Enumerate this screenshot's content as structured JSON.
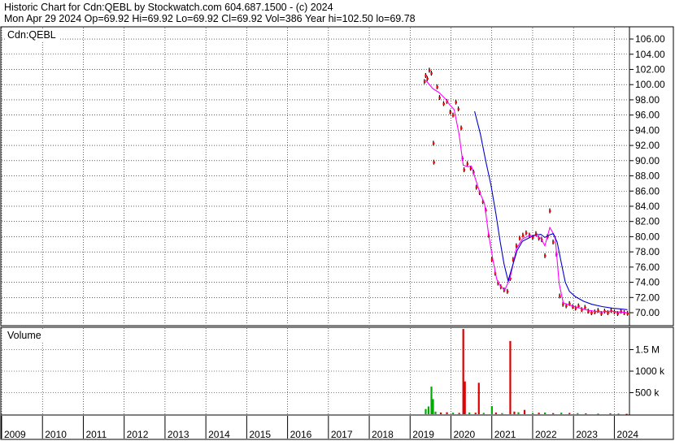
{
  "header": {
    "line1": "Historic Chart for Cdn:QEBL by Stockwatch.com 604.687.1500 - (c) 2024",
    "line2": "Mon Apr 29 2024  Op=69.92  Hi=69.92  Lo=69.92  Cl=69.92  Vol=386  Year hi=102.50  lo=69.78"
  },
  "price_panel": {
    "label": "Cdn:QEBL"
  },
  "volume_panel": {
    "label": "Volume"
  },
  "colors": {
    "grid": "#000000",
    "price_bar": "#000000",
    "price_tick": "#ff0000",
    "ma_short": "#ff00ff",
    "ma_long": "#0000cc",
    "vol_up": "#00aa00",
    "vol_down": "#dd0000"
  },
  "chart_data": [
    {
      "type": "line",
      "title": "Historic Chart for Cdn:QEBL",
      "xlabel": "",
      "ylabel": "",
      "x_ticks": [
        "2009",
        "2010",
        "2011",
        "2012",
        "2013",
        "2014",
        "2015",
        "2016",
        "2017",
        "2018",
        "2019",
        "2020",
        "2021",
        "2022",
        "2023",
        "2024"
      ],
      "y_ticks": [
        70,
        72,
        74,
        76,
        78,
        80,
        82,
        84,
        86,
        88,
        90,
        92,
        94,
        96,
        98,
        100,
        102,
        104,
        106
      ],
      "y_tick_labels": [
        "70.00",
        "72.00",
        "74.00",
        "76.00",
        "78.00",
        "80.00",
        "82.00",
        "84.00",
        "86.00",
        "88.00",
        "90.00",
        "92.00",
        "94.00",
        "96.00",
        "98.00",
        "100.00",
        "102.00",
        "104.00",
        "106.00"
      ],
      "ylim": [
        68.4,
        107.5
      ],
      "xlim": [
        2009.0,
        2024.35
      ],
      "grid": true,
      "series": [
        {
          "kind": "price",
          "points": [
            [
              2019.35,
              100.4
            ],
            [
              2019.38,
              101.2
            ],
            [
              2019.42,
              100.8
            ],
            [
              2019.47,
              101.9
            ],
            [
              2019.52,
              101.5
            ],
            [
              2019.57,
              92.3
            ],
            [
              2019.58,
              89.8
            ],
            [
              2019.66,
              99.7
            ],
            [
              2019.72,
              98.3
            ],
            [
              2019.82,
              97.5
            ],
            [
              2019.9,
              97.8
            ],
            [
              2019.98,
              96.4
            ],
            [
              2020.05,
              96.0
            ],
            [
              2020.12,
              97.7
            ],
            [
              2020.18,
              96.8
            ],
            [
              2020.25,
              94.3
            ],
            [
              2020.28,
              90.3
            ],
            [
              2020.32,
              88.8
            ],
            [
              2020.4,
              89.6
            ],
            [
              2020.48,
              89.0
            ],
            [
              2020.55,
              88.5
            ],
            [
              2020.62,
              86.5
            ],
            [
              2020.7,
              85.8
            ],
            [
              2020.78,
              84.6
            ],
            [
              2020.85,
              83.5
            ],
            [
              2020.92,
              80.2
            ],
            [
              2021.0,
              77.0
            ],
            [
              2021.08,
              75.2
            ],
            [
              2021.15,
              73.9
            ],
            [
              2021.22,
              73.4
            ],
            [
              2021.3,
              73.0
            ],
            [
              2021.38,
              72.8
            ],
            [
              2021.45,
              74.5
            ],
            [
              2021.52,
              77.0
            ],
            [
              2021.6,
              78.8
            ],
            [
              2021.68,
              79.8
            ],
            [
              2021.76,
              80.2
            ],
            [
              2021.84,
              80.5
            ],
            [
              2021.92,
              80.2
            ],
            [
              2022.0,
              79.9
            ],
            [
              2022.08,
              80.4
            ],
            [
              2022.15,
              79.8
            ],
            [
              2022.22,
              79.6
            ],
            [
              2022.3,
              77.5
            ],
            [
              2022.36,
              80.0
            ],
            [
              2022.42,
              83.4
            ],
            [
              2022.5,
              79.3
            ],
            [
              2022.58,
              77.7
            ],
            [
              2022.66,
              72.2
            ],
            [
              2022.74,
              71.1
            ],
            [
              2022.82,
              70.9
            ],
            [
              2022.9,
              71.2
            ],
            [
              2022.98,
              70.8
            ],
            [
              2023.05,
              70.6
            ],
            [
              2023.12,
              70.9
            ],
            [
              2023.2,
              70.4
            ],
            [
              2023.28,
              70.7
            ],
            [
              2023.36,
              70.2
            ],
            [
              2023.44,
              70.0
            ],
            [
              2023.52,
              70.1
            ],
            [
              2023.6,
              70.3
            ],
            [
              2023.68,
              69.9
            ],
            [
              2023.76,
              70.2
            ],
            [
              2023.84,
              70.0
            ],
            [
              2023.92,
              70.3
            ],
            [
              2024.0,
              70.1
            ],
            [
              2024.08,
              69.9
            ],
            [
              2024.16,
              70.2
            ],
            [
              2024.24,
              70.0
            ],
            [
              2024.32,
              69.92
            ]
          ]
        },
        {
          "kind": "ma_short",
          "points": [
            [
              2019.38,
              100.6
            ],
            [
              2019.55,
              99.5
            ],
            [
              2019.7,
              99.0
            ],
            [
              2019.85,
              98.2
            ],
            [
              2019.98,
              97.3
            ],
            [
              2020.08,
              96.7
            ],
            [
              2020.2,
              93.4
            ],
            [
              2020.3,
              89.4
            ],
            [
              2020.42,
              89.2
            ],
            [
              2020.5,
              89.3
            ],
            [
              2020.6,
              87.6
            ],
            [
              2020.72,
              85.6
            ],
            [
              2020.82,
              84.4
            ],
            [
              2020.92,
              80.4
            ],
            [
              2021.02,
              77.2
            ],
            [
              2021.12,
              74.4
            ],
            [
              2021.22,
              73.4
            ],
            [
              2021.32,
              73.0
            ],
            [
              2021.45,
              74.6
            ],
            [
              2021.6,
              78.4
            ],
            [
              2021.75,
              79.7
            ],
            [
              2021.9,
              80.1
            ],
            [
              2022.05,
              80.2
            ],
            [
              2022.2,
              79.8
            ],
            [
              2022.3,
              78.8
            ],
            [
              2022.42,
              81.2
            ],
            [
              2022.55,
              80.0
            ],
            [
              2022.65,
              73.8
            ],
            [
              2022.75,
              71.3
            ],
            [
              2022.9,
              71.0
            ],
            [
              2023.1,
              70.7
            ],
            [
              2023.3,
              70.4
            ],
            [
              2023.5,
              70.2
            ],
            [
              2023.7,
              70.1
            ],
            [
              2023.9,
              70.2
            ],
            [
              2024.1,
              70.1
            ],
            [
              2024.32,
              70.0
            ]
          ]
        },
        {
          "kind": "ma_long",
          "points": [
            [
              2020.58,
              96.5
            ],
            [
              2020.72,
              93.5
            ],
            [
              2020.85,
              90.0
            ],
            [
              2020.98,
              86.8
            ],
            [
              2021.1,
              83.0
            ],
            [
              2021.2,
              79.5
            ],
            [
              2021.3,
              76.4
            ],
            [
              2021.4,
              74.2
            ],
            [
              2021.52,
              76.4
            ],
            [
              2021.62,
              78.2
            ],
            [
              2021.75,
              79.4
            ],
            [
              2021.9,
              79.8
            ],
            [
              2022.05,
              80.2
            ],
            [
              2022.2,
              80.3
            ],
            [
              2022.3,
              79.9
            ],
            [
              2022.4,
              80.2
            ],
            [
              2022.5,
              80.4
            ],
            [
              2022.6,
              79.3
            ],
            [
              2022.7,
              76.6
            ],
            [
              2022.8,
              74.0
            ],
            [
              2022.9,
              72.8
            ],
            [
              2023.05,
              72.1
            ],
            [
              2023.25,
              71.5
            ],
            [
              2023.45,
              71.1
            ],
            [
              2023.7,
              70.8
            ],
            [
              2023.95,
              70.6
            ],
            [
              2024.32,
              70.4
            ]
          ]
        }
      ]
    },
    {
      "type": "bar",
      "title": "Volume",
      "y_tick_labels": [
        "500 k",
        "1000 k",
        "1.5 M"
      ],
      "y_ticks": [
        500000,
        1000000,
        1500000
      ],
      "ylim": [
        0,
        2000000
      ],
      "bars": [
        {
          "x": 2019.38,
          "v": 120000,
          "dir": "up"
        },
        {
          "x": 2019.45,
          "v": 180000,
          "dir": "up"
        },
        {
          "x": 2019.52,
          "v": 640000,
          "dir": "up"
        },
        {
          "x": 2019.56,
          "v": 350000,
          "dir": "up"
        },
        {
          "x": 2019.62,
          "v": 60000,
          "dir": "up"
        },
        {
          "x": 2019.75,
          "v": 40000,
          "dir": "down"
        },
        {
          "x": 2019.9,
          "v": 45000,
          "dir": "down"
        },
        {
          "x": 2020.05,
          "v": 35000,
          "dir": "up"
        },
        {
          "x": 2020.2,
          "v": 30000,
          "dir": "down"
        },
        {
          "x": 2020.3,
          "v": 1980000,
          "dir": "down"
        },
        {
          "x": 2020.34,
          "v": 760000,
          "dir": "down"
        },
        {
          "x": 2020.45,
          "v": 40000,
          "dir": "up"
        },
        {
          "x": 2020.6,
          "v": 35000,
          "dir": "down"
        },
        {
          "x": 2020.68,
          "v": 730000,
          "dir": "down"
        },
        {
          "x": 2020.8,
          "v": 30000,
          "dir": "up"
        },
        {
          "x": 2021.0,
          "v": 190000,
          "dir": "up"
        },
        {
          "x": 2021.1,
          "v": 40000,
          "dir": "down"
        },
        {
          "x": 2021.25,
          "v": 25000,
          "dir": "up"
        },
        {
          "x": 2021.45,
          "v": 1700000,
          "dir": "down"
        },
        {
          "x": 2021.55,
          "v": 60000,
          "dir": "down"
        },
        {
          "x": 2021.65,
          "v": 45000,
          "dir": "up"
        },
        {
          "x": 2021.8,
          "v": 100000,
          "dir": "down"
        },
        {
          "x": 2022.0,
          "v": 30000,
          "dir": "up"
        },
        {
          "x": 2022.15,
          "v": 35000,
          "dir": "down"
        },
        {
          "x": 2022.3,
          "v": 40000,
          "dir": "up"
        },
        {
          "x": 2022.5,
          "v": 25000,
          "dir": "down"
        },
        {
          "x": 2022.7,
          "v": 35000,
          "dir": "up"
        },
        {
          "x": 2022.9,
          "v": 30000,
          "dir": "down"
        },
        {
          "x": 2023.1,
          "v": 25000,
          "dir": "up"
        },
        {
          "x": 2023.3,
          "v": 20000,
          "dir": "down"
        },
        {
          "x": 2023.6,
          "v": 15000,
          "dir": "up"
        },
        {
          "x": 2023.9,
          "v": 20000,
          "dir": "down"
        },
        {
          "x": 2024.1,
          "v": 15000,
          "dir": "up"
        },
        {
          "x": 2024.3,
          "v": 10000,
          "dir": "down"
        }
      ]
    }
  ]
}
